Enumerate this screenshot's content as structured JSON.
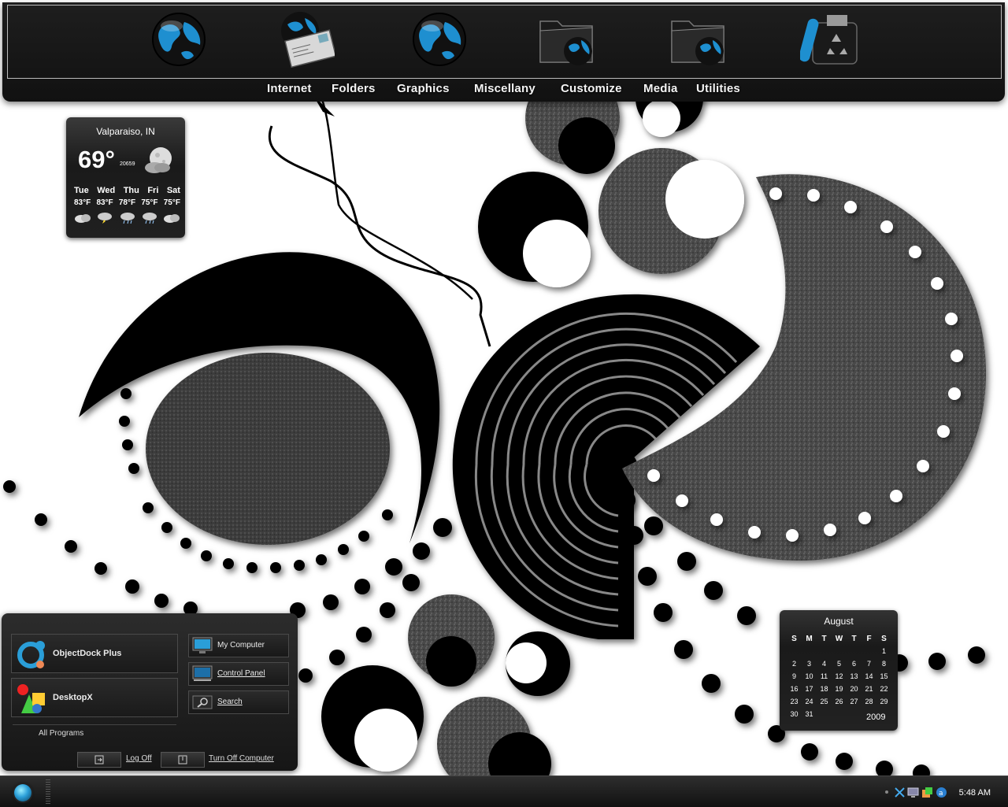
{
  "top_dock": {
    "labels": [
      "Internet",
      "Folders",
      "Graphics",
      "Miscellany",
      "Customize",
      "Media",
      "Utilities"
    ],
    "icons": [
      "globe-icon",
      "mail-globe-icon",
      "globe-icon",
      "folder-globe-icon",
      "folder-globe-icon",
      "recycle-bin-icon"
    ]
  },
  "weather": {
    "city": "Valparaiso, IN",
    "temp": "69°",
    "code": "20659",
    "days": [
      {
        "day": "Tue",
        "hi": "83°F",
        "icon": "cloudy-icon"
      },
      {
        "day": "Wed",
        "hi": "83°F",
        "icon": "storm-icon"
      },
      {
        "day": "Thu",
        "hi": "78°F",
        "icon": "rain-icon"
      },
      {
        "day": "Fri",
        "hi": "75°F",
        "icon": "rain-icon"
      },
      {
        "day": "Sat",
        "hi": "75°F",
        "icon": "cloudy-icon"
      }
    ]
  },
  "start_menu": {
    "pinned": [
      "ObjectDock Plus",
      "DesktopX"
    ],
    "all_programs": "All Programs",
    "links": [
      "My Computer",
      "Control Panel",
      "Search"
    ],
    "log_off": "Log Off",
    "turn_off": "Turn Off Computer"
  },
  "calendar": {
    "month": "August",
    "year": "2009",
    "weekdays": [
      "S",
      "M",
      "T",
      "W",
      "T",
      "F",
      "S"
    ],
    "weeks": [
      [
        "",
        "",
        "",
        "",
        "",
        "",
        "1"
      ],
      [
        "2",
        "3",
        "4",
        "5",
        "6",
        "7",
        "8"
      ],
      [
        "9",
        "10",
        "11",
        "12",
        "13",
        "14",
        "15"
      ],
      [
        "16",
        "17",
        "18",
        "19",
        "20",
        "21",
        "22"
      ],
      [
        "23",
        "24",
        "25",
        "26",
        "27",
        "28",
        "29"
      ],
      [
        "30",
        "31",
        "",
        "",
        "",
        "",
        ""
      ]
    ]
  },
  "taskbar": {
    "clock": "5:48 AM",
    "tray_icons": [
      "network-icon",
      "display-icon",
      "paint-icon",
      "updates-icon"
    ]
  },
  "colors": {
    "accent": "#2a9ed8",
    "dark": "#111111"
  }
}
